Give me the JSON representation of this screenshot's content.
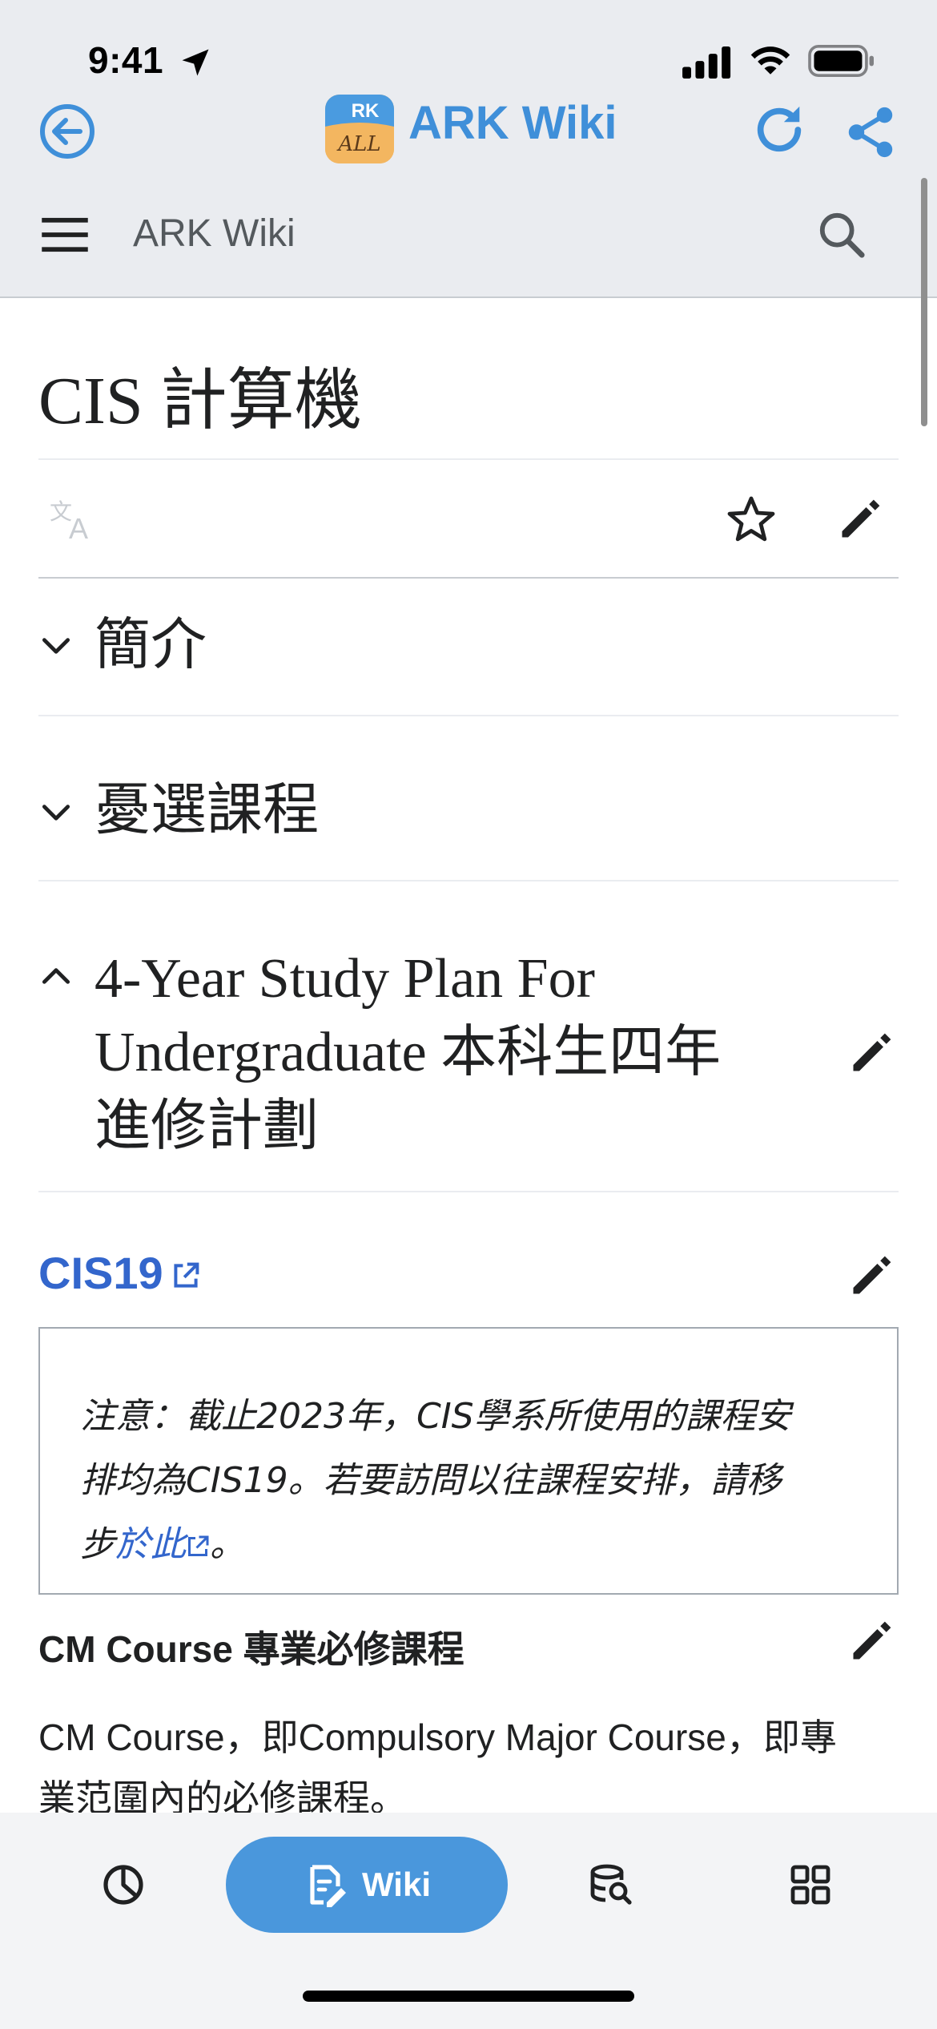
{
  "status_bar": {
    "time": "9:41"
  },
  "app_bar": {
    "title": "ARK Wiki",
    "logo_text_top": "RK",
    "logo_text_bottom": "ALL"
  },
  "wiki_header": {
    "title": "ARK Wiki"
  },
  "page": {
    "title": "CIS 計算機",
    "sections": [
      {
        "title": "簡介",
        "expanded": false
      },
      {
        "title": "憂選課程",
        "expanded": false
      },
      {
        "title_lines": [
          "4-Year Study Plan For",
          "Undergraduate 本科生四年",
          "進修計劃"
        ],
        "expanded": true
      }
    ],
    "subsection": {
      "title": "CIS19"
    },
    "note": {
      "lines": [
        "注意：截止2023年，CIS學系所使用的課程安",
        "排均為CIS19。若要訪問以往課程安排，請移"
      ],
      "line3_prefix": "步",
      "link_text": "於此",
      "line3_suffix": "。"
    },
    "cm_heading": "CM Course 專業必修課程",
    "cm_text_lines": [
      "CM Course，即Compulsory Major Course，即專",
      "業范圍內的必修課程。"
    ]
  },
  "tab_bar": {
    "active_label": "Wiki"
  },
  "colors": {
    "accent": "#3f8fd9",
    "link": "#3366cc",
    "pill": "#4a97dc",
    "header_bg": "#eaecf0"
  }
}
